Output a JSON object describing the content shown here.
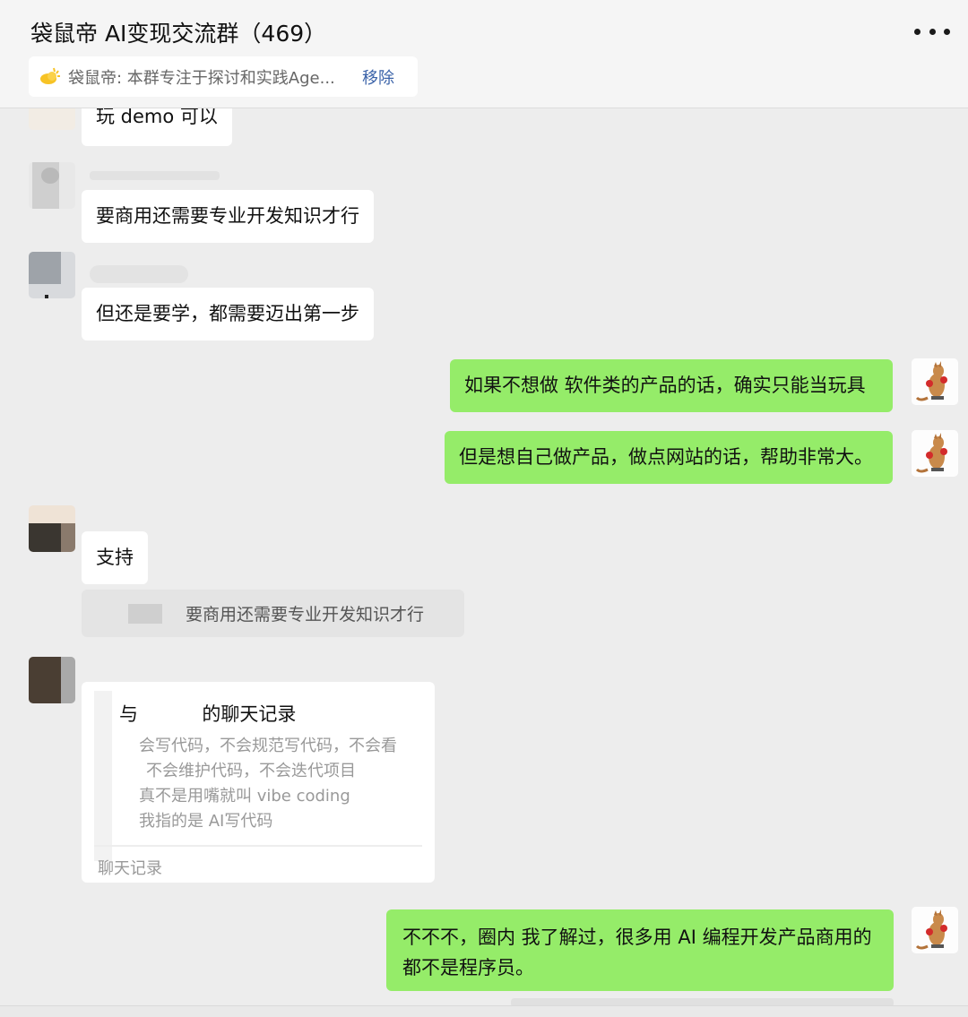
{
  "header": {
    "title": "袋鼠帝 AI变现交流群（469）",
    "more_icon": "more-dots-icon"
  },
  "notice": {
    "icon": "sun-announcement-icon",
    "text": "袋鼠帝: 本群专注于探讨和实践Age...",
    "remove_label": "移除"
  },
  "messages": [
    {
      "side": "left",
      "text": "玩 demo 可以"
    },
    {
      "side": "left",
      "text": "要商用还需要专业开发知识才行"
    },
    {
      "side": "left",
      "text": "但还是要学，都需要迈出第一步"
    },
    {
      "side": "right",
      "text": "如果不想做 软件类的产品的话，确实只能当玩具"
    },
    {
      "side": "right",
      "text": "但是想自己做产品，做点网站的话，帮助非常大。"
    },
    {
      "side": "left",
      "text": "支持"
    },
    {
      "side": "left",
      "type": "quote",
      "text": "要商用还需要专业开发知识才行"
    },
    {
      "side": "left",
      "type": "chat-record",
      "title_a": "与",
      "title_b": "的聊天记录",
      "lines": [
        "会写代码，不会规范写代码，不会看",
        "不会维护代码，不会迭代项目",
        "真不是用嘴就叫 vibe coding",
        "我指的是 AI写代码"
      ],
      "footer": "聊天记录"
    },
    {
      "side": "right",
      "text": "不不不，圈内 我了解过，很多用 AI 编程开发产品商用的都不是程序员。"
    }
  ],
  "colors": {
    "background": "#ededed",
    "bubble_self": "#95ec69",
    "bubble_other": "#ffffff",
    "link": "#3a62a8"
  },
  "self_avatar_icon": "kangaroo-boxer-avatar"
}
